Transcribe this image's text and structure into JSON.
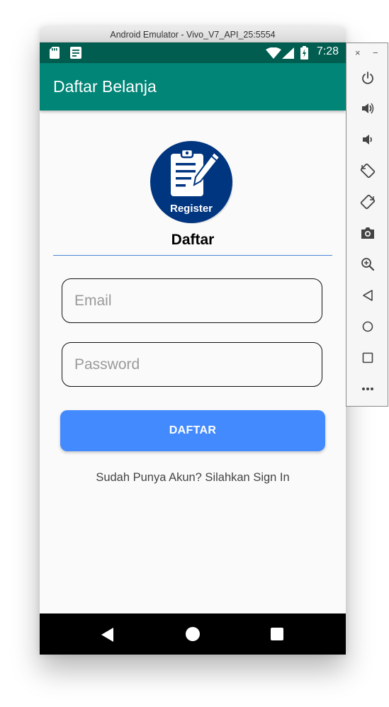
{
  "window": {
    "title": "Android Emulator - Vivo_V7_API_25:5554"
  },
  "status_bar": {
    "time": "7:28"
  },
  "app_bar": {
    "title": "Daftar Belanja"
  },
  "logo": {
    "text": "Register"
  },
  "form": {
    "heading": "Daftar",
    "email": {
      "placeholder": "Email",
      "value": ""
    },
    "password": {
      "placeholder": "Password",
      "value": ""
    },
    "submit_label": "DAFTAR",
    "signin_link": "Sudah Punya Akun? Silahkan Sign In"
  },
  "emulator_sidebar": {
    "close": "×",
    "minimize": "−",
    "tools": [
      "power-icon",
      "volume-up-icon",
      "volume-down-icon",
      "rotate-left-icon",
      "rotate-right-icon",
      "camera-icon",
      "zoom-icon",
      "back-icon",
      "home-icon",
      "overview-icon",
      "more-icon"
    ]
  },
  "colors": {
    "status_bar": "#005d4f",
    "app_bar": "#008577",
    "button": "#448aff",
    "logo": "#003580"
  }
}
